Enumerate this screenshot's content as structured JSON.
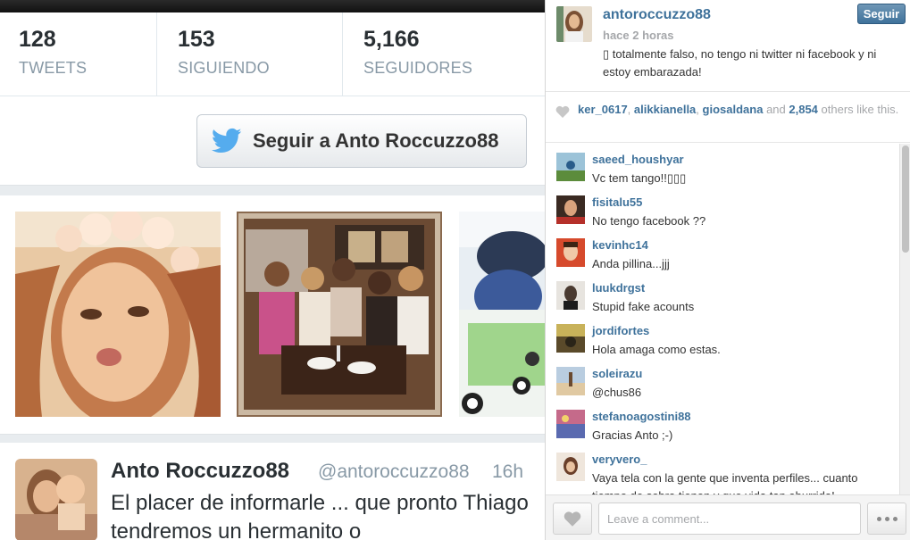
{
  "twitter": {
    "stats": [
      {
        "value": "128",
        "label": "TWEETS"
      },
      {
        "value": "153",
        "label": "SIGUIENDO"
      },
      {
        "value": "5,166",
        "label": "SEGUIDORES"
      }
    ],
    "follow_button_label": "Seguir a Anto Roccuzzo88",
    "tweet": {
      "name": "Anto Roccuzzo88",
      "handle": "@antoroccuzzo88",
      "time": "16h",
      "text": "El placer de informarle ... que pronto Thiago tendremos un hermanito o"
    },
    "brand_color": "#55acee"
  },
  "instagram": {
    "username": "antoroccuzzo88",
    "time": "hace 2 horas",
    "caption": "▯ totalmente falso, no tengo ni twitter ni facebook y ni estoy embarazada!",
    "follow_label": "Seguir",
    "likes": {
      "users": [
        "ker_0617",
        "alikkianella",
        "giosaldana"
      ],
      "sep": ", ",
      "and_text": " and ",
      "count": "2,854",
      "suffix": " others like this."
    },
    "comments": [
      {
        "user": "saeed_houshyar",
        "text": "Vc tem tango!!▯▯▯"
      },
      {
        "user": "fisitalu55",
        "text": "No tengo facebook ??"
      },
      {
        "user": "kevinhc14",
        "text": "Anda pillina...jjj"
      },
      {
        "user": "luukdrgst",
        "text": "Stupid fake acounts"
      },
      {
        "user": "jordifortes",
        "text": "Hola amaga como estas."
      },
      {
        "user": "soleirazu",
        "text": "@chus86"
      },
      {
        "user": "stefanoagostini88",
        "text": "Gracias Anto ;-)"
      },
      {
        "user": "veryvero_",
        "text": "Vaya tela con la gente que inventa perfiles... cuanto tiempo de sobra tienen y que vida tan aburrida!"
      }
    ],
    "comment_placeholder": "Leave a comment...",
    "accent_color": "#3f729b"
  }
}
